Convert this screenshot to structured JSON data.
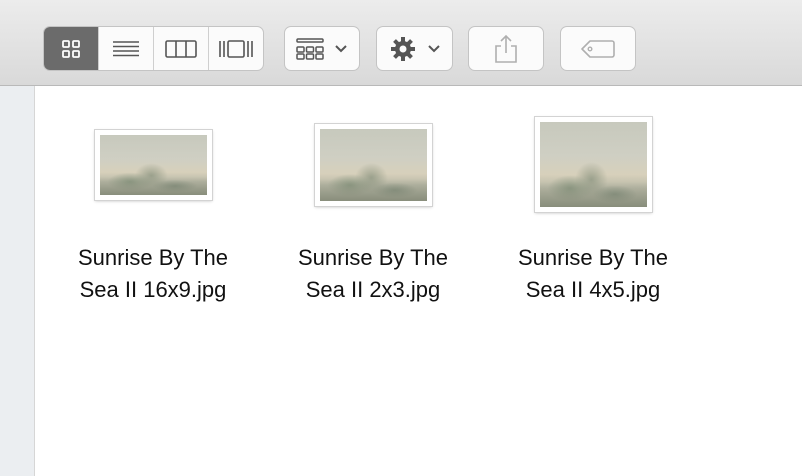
{
  "toolbar": {
    "view_modes": [
      {
        "name": "icon-view",
        "icon": "icon-grid-icon",
        "active": true
      },
      {
        "name": "list-view",
        "icon": "list-lines-icon",
        "active": false
      },
      {
        "name": "column-view",
        "icon": "columns-icon",
        "active": false
      },
      {
        "name": "gallery-view",
        "icon": "gallery-icon",
        "active": false
      }
    ],
    "group_button_icon": "arrange-grid-icon",
    "action_button_icon": "gear-icon",
    "share_button_icon": "share-icon",
    "tag_button_icon": "tag-icon",
    "active_color": "#6b6b6b"
  },
  "files": [
    {
      "name": "Sunrise By The\nSea  II 16x9.jpg"
    },
    {
      "name": "Sunrise By The\nSea II 2x3.jpg"
    },
    {
      "name": "Sunrise By The\nSea II 4x5.jpg"
    }
  ]
}
